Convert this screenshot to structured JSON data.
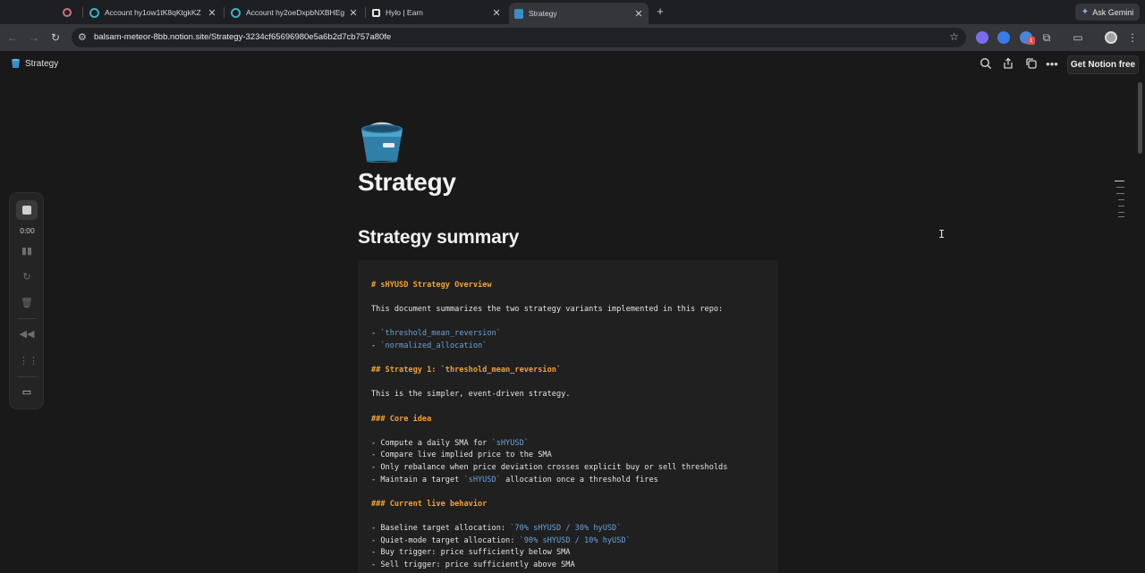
{
  "browser": {
    "tabs": [
      {
        "title": "",
        "favicon_color": "#d16d7e"
      },
      {
        "title": "Account hy1ow1tK8qKtgkKZ",
        "favicon_color": "#3fb0c2"
      },
      {
        "title": "Account hy2oeDxpbNXBHEg",
        "favicon_color": "#3fb0c2"
      },
      {
        "title": "Hylo | Earn",
        "favicon_color": "#e8e8e8"
      },
      {
        "title": "Strategy",
        "favicon_color": "#3b8fc7"
      }
    ],
    "active_tab_index": 4,
    "new_tab_symbol": "+",
    "ask_gemini_label": "Ask Gemini",
    "url": "balsam-meteor-8bb.notion.site/Strategy-3234cf65696980e5a6b2d7cb757a80fe",
    "extension_badge": "1"
  },
  "notion": {
    "breadcrumb_title": "Strategy",
    "get_free_label": "Get Notion free"
  },
  "page": {
    "title": "Strategy",
    "heading": "Strategy summary",
    "code_lines": [
      [
        {
          "t": "# sHYUSD Strategy Overview",
          "c": "hd"
        }
      ],
      [],
      [
        {
          "t": "This document summarizes the two strategy variants implemented in this repo:"
        }
      ],
      [],
      [
        {
          "t": "- "
        },
        {
          "t": "`threshold_mean_reversion`",
          "c": "tk"
        }
      ],
      [
        {
          "t": "- "
        },
        {
          "t": "`normalized_allocation`",
          "c": "tk"
        }
      ],
      [],
      [
        {
          "t": "## Strategy 1: `threshold_mean_reversion`",
          "c": "hd"
        }
      ],
      [],
      [
        {
          "t": "This is the simpler, event-driven strategy."
        }
      ],
      [],
      [
        {
          "t": "### Core idea",
          "c": "hd"
        }
      ],
      [],
      [
        {
          "t": "- Compute a daily SMA for "
        },
        {
          "t": "`sHYUSD`",
          "c": "tk"
        }
      ],
      [
        {
          "t": "- Compare live implied price to the SMA"
        }
      ],
      [
        {
          "t": "- Only rebalance when price deviation crosses explicit buy or sell thresholds"
        }
      ],
      [
        {
          "t": "- Maintain a target "
        },
        {
          "t": "`sHYUSD`",
          "c": "tk"
        },
        {
          "t": " allocation once a threshold fires"
        }
      ],
      [],
      [
        {
          "t": "### Current live behavior",
          "c": "hd"
        }
      ],
      [],
      [
        {
          "t": "- Baseline target allocation: "
        },
        {
          "t": "`70% sHYUSD / 30% hyUSD`",
          "c": "tk"
        }
      ],
      [
        {
          "t": "- Quiet-mode target allocation: "
        },
        {
          "t": "`90% sHYUSD / 10% hyUSD`",
          "c": "tk"
        }
      ],
      [
        {
          "t": "- Buy trigger: price sufficiently below SMA"
        }
      ],
      [
        {
          "t": "- Sell trigger: price sufficiently above SMA"
        }
      ]
    ]
  },
  "recorder": {
    "time": "0:00"
  },
  "colors": {
    "background": "#191919",
    "code_heading": "#f0a13a",
    "code_token": "#6aa2d8"
  },
  "icons": [
    "record-icon",
    "search-icon",
    "share-icon",
    "duplicate-icon",
    "more-icon",
    "star-icon",
    "bucket-icon"
  ]
}
